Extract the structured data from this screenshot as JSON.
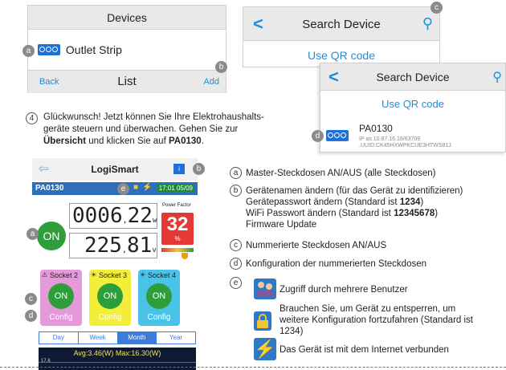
{
  "devices_panel": {
    "title": "Devices",
    "item_label": "Outlet Strip",
    "back_label": "Back",
    "list_title": "List",
    "add_label": "Add"
  },
  "search_panel_1": {
    "title": "Search Device",
    "qr_label": "Use QR code"
  },
  "search_panel_2": {
    "title": "Search Device",
    "qr_label": "Use QR code",
    "device_name": "PA0130",
    "device_ip": "IP as 10.87.16.18/63709",
    "device_uuid": ",UUID:CK45HXWPKCUE3HTWS81J"
  },
  "markers": {
    "a": "a",
    "b": "b",
    "c": "c",
    "d": "d",
    "e": "e",
    "step": "4"
  },
  "instruction": {
    "line1": "Glückwunsch! Jetzt können Sie Ihre Elektrohaushalts-",
    "line2": "geräte steuern und überwachen. Gehen Sie zur",
    "line3_bold": "Übersicht",
    "line3_mid": " und klicken Sie auf ",
    "line3_bold2": "PA0130",
    "line3_end": "."
  },
  "app": {
    "title": "LogiSmart",
    "device_id": "PA0130",
    "time": "17:01 05/09",
    "on_label": "ON",
    "energy_digits": "0006",
    "energy_dec": "22",
    "energy_unit": "w",
    "voltage_digits": "225",
    "voltage_dec": "81",
    "voltage_unit": "v",
    "power_factor_label": "Power Factor",
    "power_factor_value": "32",
    "power_factor_unit": "%",
    "sockets": [
      {
        "label": "Socket 2",
        "on": "ON",
        "config": "Config",
        "color": "#e49ad9"
      },
      {
        "label": "Socket 3",
        "on": "ON",
        "config": "Config",
        "color": "#f2ee3a"
      },
      {
        "label": "Socket 4",
        "on": "ON",
        "config": "Config",
        "color": "#4ac3e8"
      }
    ],
    "tabs": [
      "Day",
      "Week",
      "Month",
      "Year"
    ],
    "active_tab": "Month",
    "stats": "Avg:3.46(W)  Max:16.30(W)",
    "chart_tick": "17.6"
  },
  "descriptions": {
    "a": "Master-Steckdosen AN/AUS (alle Steckdosen)",
    "b_line1": "Gerätenamen ändern (für das Gerät zu identifizieren)",
    "b_line2_pre": "Gerätepasswort ändern (Standard ist ",
    "b_line2_bold": "1234",
    "b_line2_post": ")",
    "b_line3_pre": "WiFi Passwort ändern (Standard ist ",
    "b_line3_bold": "12345678",
    "b_line3_post": ")",
    "b_line4": "Firmware Update",
    "c": "Nummerierte Steckdosen AN/AUS",
    "d": "Konfiguration der nummerierten Steckdosen",
    "e1": "Zugriff durch mehrere Benutzer",
    "e2_line1": "Brauchen Sie, um Gerät zu entsperren, um",
    "e2_line2": "weitere Konfiguration fortzufahren (Standard ist",
    "e2_line3": "1234)",
    "e3": "Das Gerät ist mit dem Internet verbunden"
  }
}
